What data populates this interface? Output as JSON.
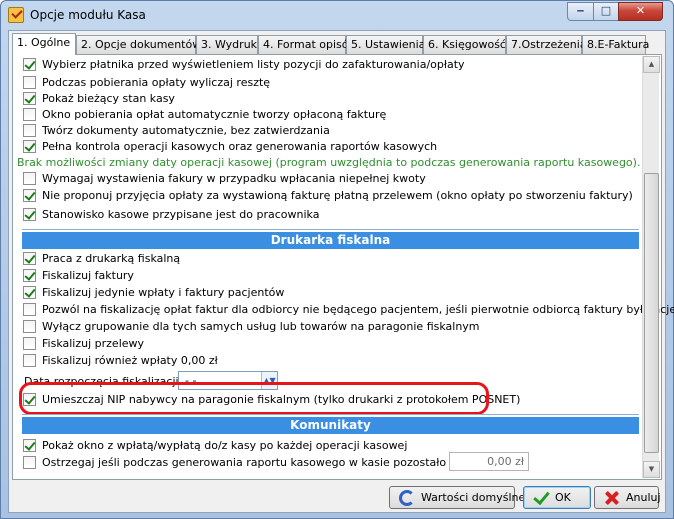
{
  "window": {
    "title": "Opcje modułu Kasa",
    "minimize": "‒",
    "maximize": "□",
    "close": "✕"
  },
  "tabs": [
    {
      "label": "1. Ogólne",
      "active": true
    },
    {
      "label": "2. Opcje dokumentów"
    },
    {
      "label": "3. Wydruki"
    },
    {
      "label": "4. Format opisów"
    },
    {
      "label": "5. Ustawienia"
    },
    {
      "label": "6. Księgowość"
    },
    {
      "label": "7.Ostrzeżenia"
    },
    {
      "label": "8.E-Faktura"
    }
  ],
  "general_options": [
    {
      "label": "Wybierz płatnika przed wyświetleniem listy pozycji do zafakturowania/opłaty",
      "checked": true
    },
    {
      "label": "Podczas pobierania opłaty wyliczaj resztę",
      "checked": false
    },
    {
      "label": "Pokaż bieżący stan kasy",
      "checked": true
    },
    {
      "label": "Okno pobierania opłat automatycznie tworzy opłaconą fakturę",
      "checked": false
    },
    {
      "label": "Twórz dokumenty automatycznie, bez zatwierdzania",
      "checked": false
    },
    {
      "label": "Pełna kontrola operacji kasowych oraz generowania raportów kasowych",
      "checked": true
    }
  ],
  "note": "Brak możliwości zmiany daty operacji kasowej (program uwzględnia to podczas generowania raportu kasowego).",
  "general_options_2": [
    {
      "label": "Wymagaj wystawienia fakury w przypadku wpłacania niepełnej kwoty",
      "checked": false
    },
    {
      "label": "Nie proponuj przyjęcia opłaty za wystawioną  fakturę płatną przelewem (okno opłaty po stworzeniu faktury)",
      "checked": true
    },
    {
      "label": "Stanowisko kasowe przypisane jest do pracownika",
      "checked": true
    }
  ],
  "fiscal_header": "Drukarka fiskalna",
  "fiscal_options": [
    {
      "label": "Praca z drukarką fiskalną",
      "checked": true
    },
    {
      "label": "Fiskalizuj faktury",
      "checked": true
    },
    {
      "label": "Fiskalizuj jedynie wpłaty i faktury pacjentów",
      "checked": true
    },
    {
      "label": "Pozwól na fiskalizację opłat faktur dla odbiorcy nie będącego pacjentem, jeśli pierwotnie odbiorcą faktury był pacjent",
      "checked": false
    },
    {
      "label": "Wyłącz grupowanie dla tych samych usług lub towarów na paragonie fiskalnym",
      "checked": false
    },
    {
      "label": "Fiskalizuj przelewy",
      "checked": false
    },
    {
      "label": "Fiskalizuj również wpłaty 0,00 zł",
      "checked": false
    }
  ],
  "fiscal_date": {
    "label": "Data rozpoczęcia fiskalizacji:",
    "value": "-    -"
  },
  "nip_option": {
    "label": "Umieszczaj NIP nabywcy na paragonie fiskalnym (tylko drukarki z protokołem POSNET)",
    "checked": true
  },
  "section3_header": "Komunikaty",
  "section3_options": [
    {
      "label": "Pokaż okno z wpłatą/wypłatą do/z kasy po każdej operacji kasowej",
      "checked": true
    },
    {
      "label": "Ostrzegaj jeśli podczas generowania raportu kasowego w kasie pozostało więcej niż",
      "checked": false
    }
  ],
  "threshold": "0,00 zł",
  "buttons": {
    "defaults": "Wartości domyślne",
    "ok": "OK",
    "cancel": "Anuluj"
  },
  "colors": {
    "section_bar": "#3a8fe2",
    "highlight": "#e8141b",
    "note": "#2f8f2f"
  }
}
